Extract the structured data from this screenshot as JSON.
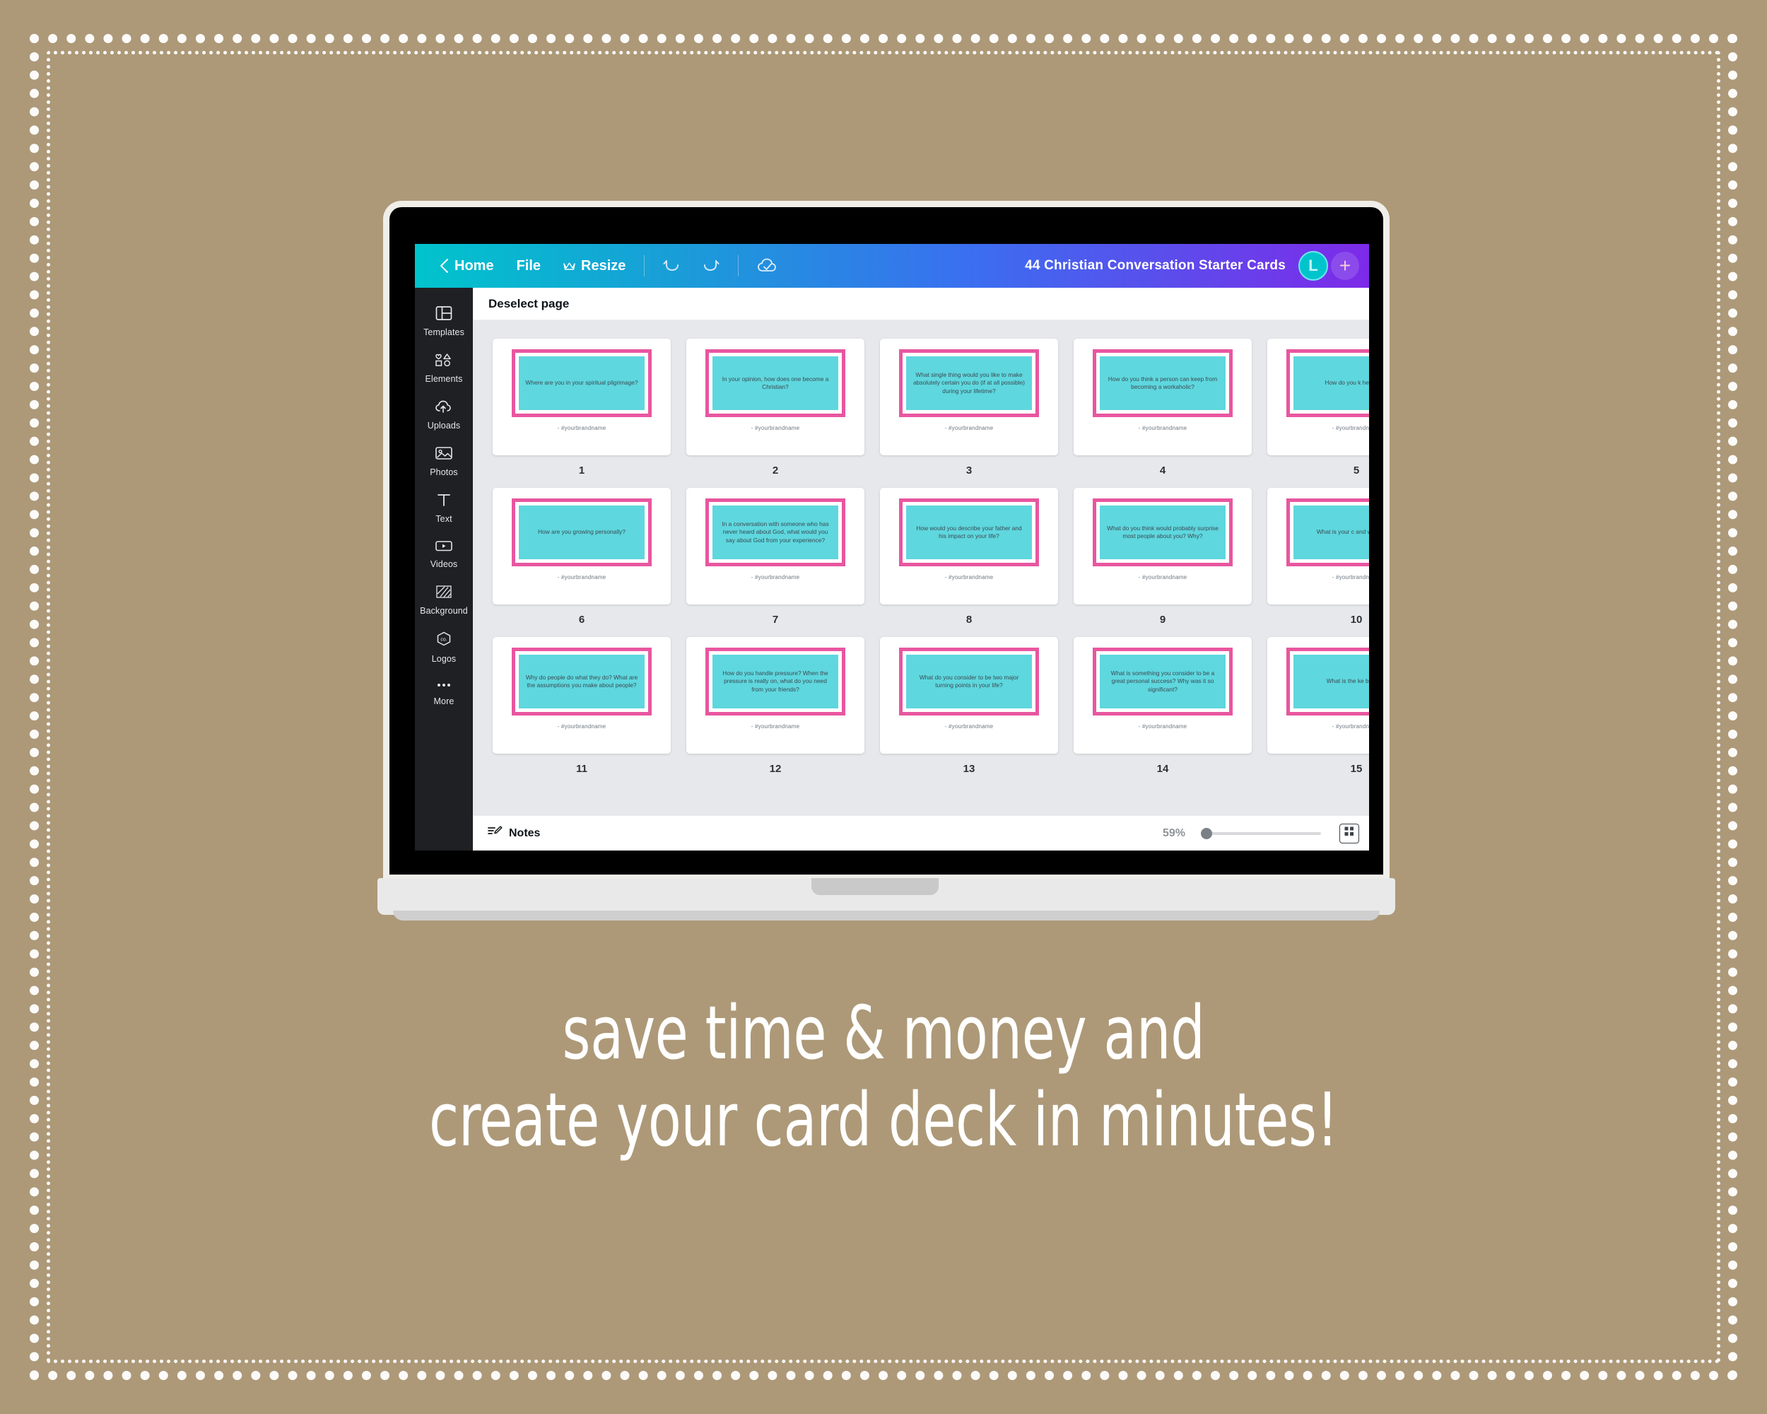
{
  "theme": {
    "background": "#ad9978",
    "accent_pink": "#e8569f",
    "accent_teal": "#5ed7de",
    "sidebar_bg": "#1f2023",
    "canvas_bg": "#e7e8ec"
  },
  "topbar": {
    "back_icon": "chevron-left-icon",
    "home_label": "Home",
    "file_label": "File",
    "resize_icon": "crown-icon",
    "resize_label": "Resize",
    "undo_icon": "undo-icon",
    "redo_icon": "redo-icon",
    "saved_icon": "cloud-check-icon",
    "doc_title": "44 Christian Conversation Starter Cards",
    "avatar_initial": "L",
    "add_label": "+"
  },
  "sidebar": {
    "items": [
      {
        "label": "Templates",
        "icon": "templates-icon"
      },
      {
        "label": "Elements",
        "icon": "elements-icon"
      },
      {
        "label": "Uploads",
        "icon": "upload-cloud-icon"
      },
      {
        "label": "Photos",
        "icon": "photo-icon"
      },
      {
        "label": "Text",
        "icon": "text-icon"
      },
      {
        "label": "Videos",
        "icon": "video-icon"
      },
      {
        "label": "Background",
        "icon": "background-icon"
      },
      {
        "label": "Logos",
        "icon": "logos-icon"
      },
      {
        "label": "More",
        "icon": "more-dots-icon"
      }
    ]
  },
  "canvas": {
    "deselect_label": "Deselect page",
    "brand_credit": "- #yourbrandname",
    "pages": [
      {
        "number": "1",
        "question": "Where are you in your spiritual pilgrimage?"
      },
      {
        "number": "2",
        "question": "In your opinion, how does one become a Christian?"
      },
      {
        "number": "3",
        "question": "What single thing would you like to make absolutely certain you do (if at all possible) during your lifetime?"
      },
      {
        "number": "4",
        "question": "How do you think a person can keep from becoming a workaholic?"
      },
      {
        "number": "5",
        "question": "How do you k heaven w"
      },
      {
        "number": "6",
        "question": "How are you growing personally?"
      },
      {
        "number": "7",
        "question": "In a conversation with someone who has never heard about God, what would you say about God from your experience?"
      },
      {
        "number": "8",
        "question": "How would you describe your father and his impact on your life?"
      },
      {
        "number": "9",
        "question": "What do you think would probably surprise most people about you? Why?"
      },
      {
        "number": "10",
        "question": "What is your c and what a dev"
      },
      {
        "number": "11",
        "question": "Why do people do what they do? What are the assumptions you make about people?"
      },
      {
        "number": "12",
        "question": "How do you handle pressure? When the pressure is really on, what do you need from your friends?"
      },
      {
        "number": "13",
        "question": "What do you consider to be two major turning points in your life?"
      },
      {
        "number": "14",
        "question": "What is something you consider to be a great personal success? Why was it so significant?"
      },
      {
        "number": "15",
        "question": "What is the ke balance"
      }
    ]
  },
  "bottombar": {
    "notes_icon": "notes-icon",
    "notes_label": "Notes",
    "zoom_level": "59%",
    "grid_view_icon": "grid-view-icon"
  },
  "promo": {
    "line1": "save time & money and",
    "line2": "create your card deck in minutes!"
  }
}
